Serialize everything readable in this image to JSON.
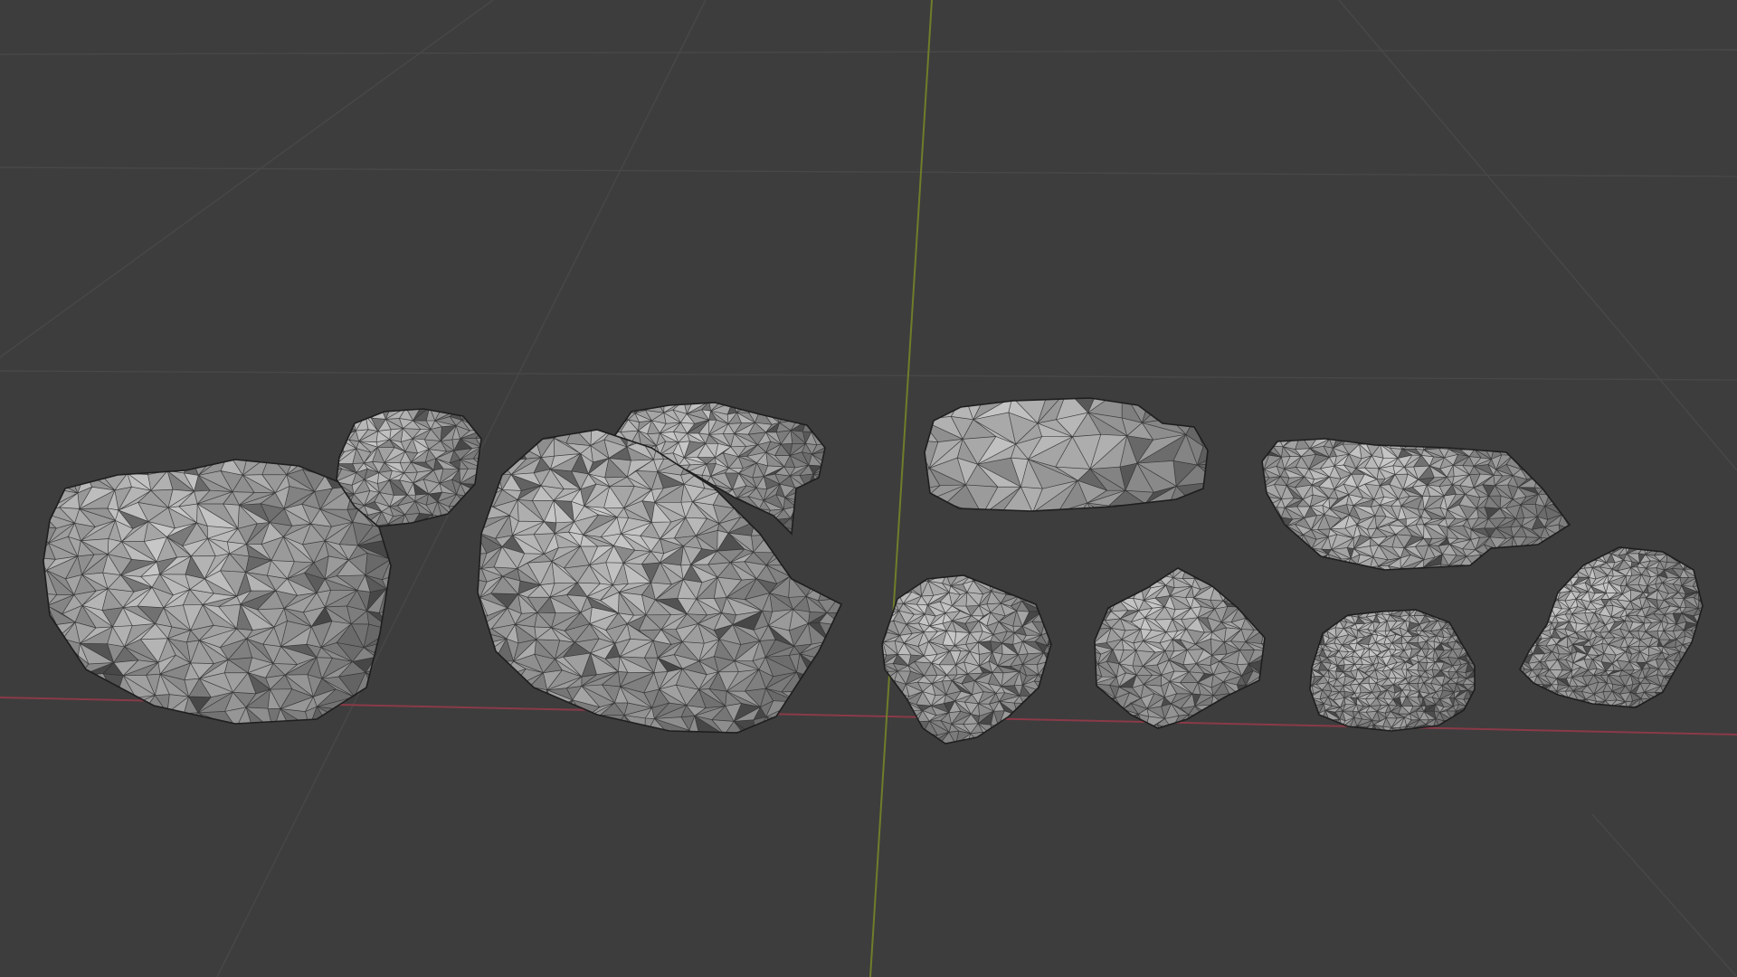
{
  "viewport": {
    "background_color": "#3d3d3d",
    "grid_color": "#484848",
    "x_axis_color": "#8a3a48",
    "y_axis_color": "#6f7d2a",
    "mesh_face_color": "#a9a9a9",
    "mesh_light_color": "#c4c4c4",
    "mesh_shadow_color": "#6e6e6e",
    "mesh_wire_color": "#2a2a2a",
    "shading_mode": "solid-wireframe"
  },
  "objects": [
    {
      "label": "rock-large-left"
    },
    {
      "label": "rock-small-back-left"
    },
    {
      "label": "rock-boulder-center"
    },
    {
      "label": "rock-chunk-behind-boulder"
    },
    {
      "label": "rock-flat-slab"
    },
    {
      "label": "rock-flat-plate-right"
    },
    {
      "label": "rock-medium-1"
    },
    {
      "label": "rock-medium-2"
    },
    {
      "label": "rock-medium-3"
    },
    {
      "label": "rock-medium-4"
    }
  ]
}
